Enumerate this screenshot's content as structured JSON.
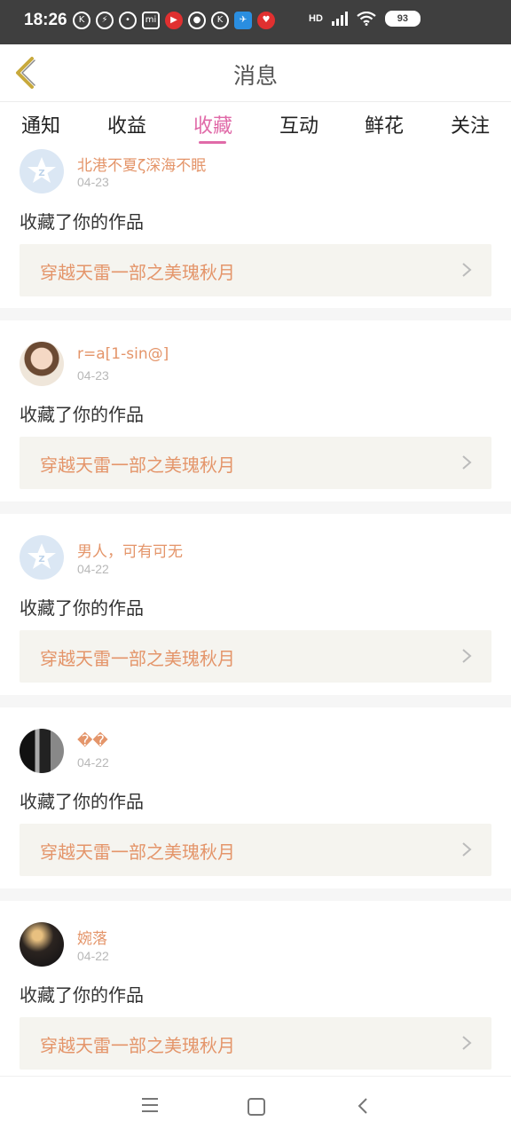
{
  "status_bar": {
    "time": "18:26",
    "signal": "HD",
    "battery": "93"
  },
  "header": {
    "title": "消息"
  },
  "tabs": [
    {
      "label": "通知",
      "active": false
    },
    {
      "label": "收益",
      "active": false
    },
    {
      "label": "收藏",
      "active": true
    },
    {
      "label": "互动",
      "active": false
    },
    {
      "label": "鲜花",
      "active": false
    },
    {
      "label": "关注",
      "active": false
    }
  ],
  "messages": [
    {
      "user": "北港不夏ζ深海不眠",
      "date": "04-23",
      "action": "收藏了你的作品",
      "work": "穿越天雷一部之美瑰秋月",
      "avatar": "default-avatar"
    },
    {
      "user": "r=a[1-sin@]",
      "date": "04-23",
      "action": "收藏了你的作品",
      "work": "穿越天雷一部之美瑰秋月",
      "avatar": "photo-avatar"
    },
    {
      "user": "男人，可有可无",
      "date": "04-22",
      "action": "收藏了你的作品",
      "work": "穿越天雷一部之美瑰秋月",
      "avatar": "default-avatar"
    },
    {
      "user": "��",
      "date": "04-22",
      "action": "收藏了你的作品",
      "work": "穿越天雷一部之美瑰秋月",
      "avatar": "photo-avatar"
    },
    {
      "user": "婉落",
      "date": "04-22",
      "action": "收藏了你的作品",
      "work": "穿越天雷一部之美瑰秋月",
      "avatar": "photo-avatar"
    }
  ],
  "colors": {
    "accent_pink": "#e06aa8",
    "username_orange": "#e4956a",
    "back_arrow": "#c8a93c"
  }
}
